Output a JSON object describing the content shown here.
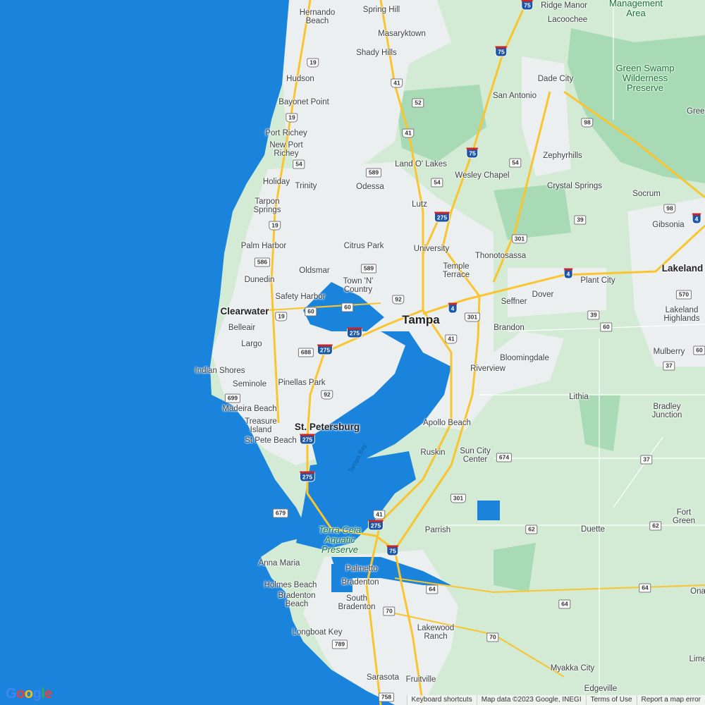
{
  "map": {
    "colors": {
      "water": "#1a84dd",
      "land": "#d3ebd4",
      "park": "#a8dab5",
      "urban": "#eef0f0",
      "highway": "#f9c52f",
      "road": "#ffffff"
    }
  },
  "places": [
    "Hernando\nBeach",
    "Spring Hill",
    "Masaryktown",
    "Ridge Manor",
    "Lacoochee",
    "Management\nArea",
    "Shady Hills",
    "Hudson",
    "Dade City",
    "Green Swamp\nWilderness\nPreserve",
    "San Antonio",
    "Bayonet Point",
    "Green",
    "Port Richey",
    "New Port\nRichey",
    "Zephyrhills",
    "Land O' Lakes",
    "Wesley Chapel",
    "Holiday",
    "Trinity",
    "Odessa",
    "Crystal Springs",
    "Socrum",
    "Tarpon\nSprings",
    "Lutz",
    "Gibsonia",
    "Palm Harbor",
    "Citrus Park",
    "University",
    "Thonotosassa",
    "Temple\nTerrace",
    "Lakeland",
    "Oldsmar",
    "Plant City",
    "Dunedin",
    "Town 'N'\nCountry",
    "Dover",
    "Safety Harbor",
    "Seffner",
    "Clearwater",
    "Lakeland\nHighlands",
    "Tampa",
    "Brandon",
    "Belleair",
    "Largo",
    "Mulberry",
    "Bloomingdale",
    "Indian Shores",
    "Riverview",
    "Seminole",
    "Pinellas Park",
    "Lithia",
    "Bradley\nJunction",
    "Madeira Beach",
    "Treasure\nIsland",
    "St. Petersburg",
    "Apollo Beach",
    "St Pete Beach",
    "Tampa Bay",
    "Ruskin",
    "Sun City\nCenter",
    "Parrish",
    "Terra Ceia\nAquatic\nPreserve",
    "Duette",
    "Fort Green",
    "Anna Maria",
    "Palmetto",
    "Holmes Beach",
    "Bradenton",
    "Bradenton\nBeach",
    "South\nBradenton",
    "Ona",
    "Lakewood\nRanch",
    "Longboat Key",
    "Myakka City",
    "Lime",
    "Sarasota",
    "Fruitville",
    "Edgeville"
  ],
  "shields": [
    "75",
    "19",
    "75",
    "41",
    "52",
    "19",
    "98",
    "41",
    "75",
    "54",
    "54",
    "589",
    "54",
    "275",
    "39",
    "301",
    "98",
    "4",
    "19",
    "586",
    "589",
    "4",
    "92",
    "570",
    "60",
    "60",
    "4",
    "301",
    "19",
    "39",
    "275",
    "60",
    "688",
    "275",
    "41",
    "60",
    "37",
    "92",
    "699",
    "275",
    "275",
    "674",
    "37",
    "301",
    "679",
    "41",
    "275",
    "62",
    "62",
    "75",
    "64",
    "64",
    "64",
    "70",
    "70",
    "789",
    "758"
  ],
  "logo": "Google",
  "footer": {
    "keyboard_shortcuts": "Keyboard shortcuts",
    "map_data": "Map data ©2023 Google, INEGI",
    "terms": "Terms of Use",
    "report": "Report a map error"
  }
}
